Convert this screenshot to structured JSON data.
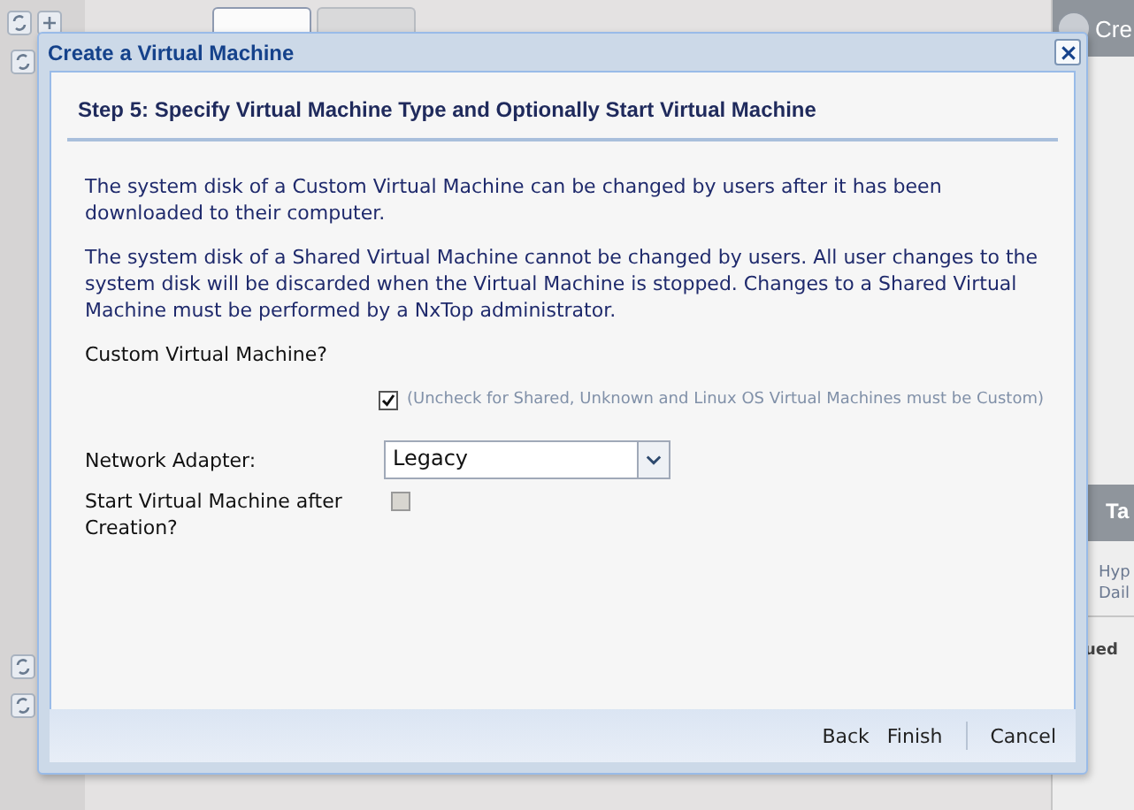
{
  "background": {
    "tabs": [
      {
        "selected": true
      },
      {
        "selected": false
      }
    ],
    "right_panel": {
      "button": "Cre",
      "header": "Ta",
      "rows": [
        "Hyp",
        "Dail"
      ],
      "status": "ued"
    }
  },
  "dialog": {
    "title": "Create a Virtual Machine",
    "step_title": "Step 5: Specify Virtual Machine Type and Optionally Start Virtual Machine",
    "paragraphs": [
      "The system disk of a Custom Virtual Machine can be changed by users after it has been downloaded to their computer.",
      "The system disk of a Shared Virtual Machine cannot be changed by users. All user changes to the system disk will be discarded when the Virtual Machine is stopped. Changes to a Shared Virtual Machine must be performed by a NxTop administrator."
    ],
    "custom_vm": {
      "label": "Custom Virtual Machine?",
      "checked": true,
      "disabled": false,
      "hint": "(Uncheck for Shared, Unknown and Linux OS Virtual Machines must be Custom)"
    },
    "network_adapter": {
      "label": "Network Adapter:",
      "value": "Legacy"
    },
    "start_vm": {
      "label": "Start Virtual Machine after Creation?",
      "checked": false,
      "disabled": true
    },
    "buttons": [
      "Back",
      "Finish",
      "Cancel"
    ]
  }
}
